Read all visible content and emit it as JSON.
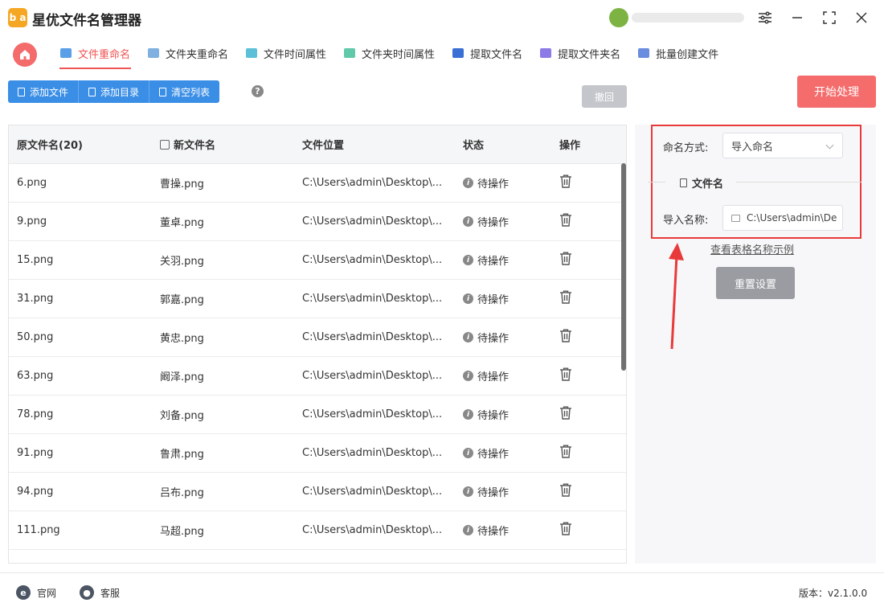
{
  "app": {
    "title": "星优文件名管理器",
    "logo_text": "b a"
  },
  "nav": {
    "tabs": [
      {
        "label": "文件重命名",
        "color": "#5aa0e8"
      },
      {
        "label": "文件夹重命名",
        "color": "#7fb0e0"
      },
      {
        "label": "文件时间属性",
        "color": "#5cc0d8"
      },
      {
        "label": "文件夹时间属性",
        "color": "#5fc9a9"
      },
      {
        "label": "提取文件名",
        "color": "#3a6fd6"
      },
      {
        "label": "提取文件夹名",
        "color": "#8c7ae6"
      },
      {
        "label": "批量创建文件",
        "color": "#6a8de0"
      }
    ]
  },
  "toolbar": {
    "add_file": "添加文件",
    "add_dir": "添加目录",
    "clear_list": "清空列表",
    "help": "?",
    "undo": "撤回",
    "start": "开始处理"
  },
  "table": {
    "headers": [
      "原文件名(20)",
      "新文件名",
      "文件位置",
      "状态",
      "操作"
    ],
    "rows": [
      {
        "orig": "6.png",
        "new": "曹操.png",
        "path": "C:\\Users\\admin\\Desktop\\...",
        "status": "待操作"
      },
      {
        "orig": "9.png",
        "new": "董卓.png",
        "path": "C:\\Users\\admin\\Desktop\\...",
        "status": "待操作"
      },
      {
        "orig": "15.png",
        "new": "关羽.png",
        "path": "C:\\Users\\admin\\Desktop\\...",
        "status": "待操作"
      },
      {
        "orig": "31.png",
        "new": "郭嘉.png",
        "path": "C:\\Users\\admin\\Desktop\\...",
        "status": "待操作"
      },
      {
        "orig": "50.png",
        "new": "黄忠.png",
        "path": "C:\\Users\\admin\\Desktop\\...",
        "status": "待操作"
      },
      {
        "orig": "63.png",
        "new": "阚泽.png",
        "path": "C:\\Users\\admin\\Desktop\\...",
        "status": "待操作"
      },
      {
        "orig": "78.png",
        "new": "刘备.png",
        "path": "C:\\Users\\admin\\Desktop\\...",
        "status": "待操作"
      },
      {
        "orig": "91.png",
        "new": "鲁肃.png",
        "path": "C:\\Users\\admin\\Desktop\\...",
        "status": "待操作"
      },
      {
        "orig": "94.png",
        "new": "吕布.png",
        "path": "C:\\Users\\admin\\Desktop\\...",
        "status": "待操作"
      },
      {
        "orig": "111.png",
        "new": "马超.png",
        "path": "C:\\Users\\admin\\Desktop\\...",
        "status": "待操作"
      }
    ]
  },
  "panel": {
    "naming_label": "命名方式:",
    "naming_value": "导入命名",
    "section_title": "文件名",
    "import_label": "导入名称:",
    "import_value": "C:\\Users\\admin\\De",
    "example_link": "查看表格名称示例",
    "reset": "重置设置"
  },
  "footer": {
    "website": "官网",
    "support": "客服",
    "version": "版本：v2.1.0.0"
  },
  "colors": {
    "accent": "#f05353",
    "primary": "#3a8ee6",
    "highlight_box": "#e83a3a"
  }
}
